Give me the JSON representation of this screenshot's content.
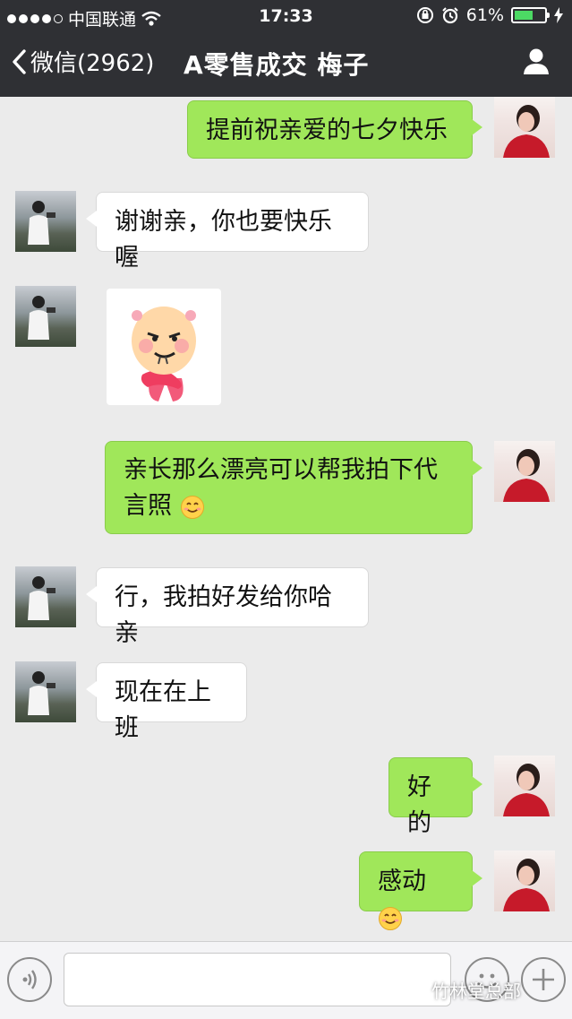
{
  "status_bar": {
    "carrier": "中国联通",
    "time": "17:33",
    "battery": "61%",
    "battery_level": 0.61
  },
  "nav": {
    "back_label": "微信(2962)",
    "title": "A零售成交 梅子"
  },
  "messages": [
    {
      "side": "right",
      "type": "text",
      "text": "提前祝亲爱的七夕快乐"
    },
    {
      "side": "left",
      "type": "text",
      "text": "谢谢亲，你也要快乐喔"
    },
    {
      "side": "left",
      "type": "sticker",
      "icon": "cartoon-face-sticker"
    },
    {
      "side": "right",
      "type": "text",
      "text_line1": "亲长那么漂亮可以帮我拍下代",
      "text_line2": "言照",
      "icon": "smile-emoji"
    },
    {
      "side": "left",
      "type": "text",
      "text": "行，我拍好发给你哈亲"
    },
    {
      "side": "left",
      "type": "text",
      "text": "现在在上班"
    },
    {
      "side": "right",
      "type": "text",
      "text": "好的"
    },
    {
      "side": "right",
      "type": "text",
      "text": "感动",
      "icon": "smile-emoji"
    }
  ],
  "watermark": "竹林堂总部",
  "colors": {
    "bubble_self": "#a0e75a",
    "bubble_other": "#ffffff",
    "top_bar": "#2f3034",
    "background": "#ebebeb"
  }
}
